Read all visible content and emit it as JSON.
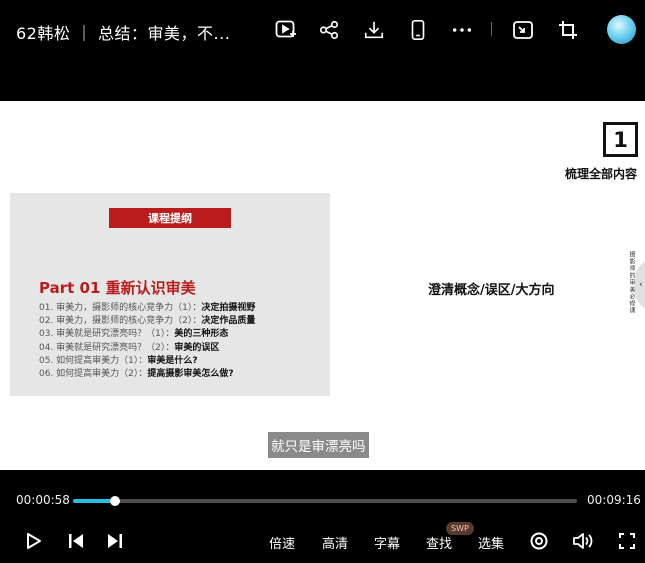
{
  "header": {
    "title": "62韩松 ｜ 总结：审美，不...",
    "icons": [
      "picture-in-picture-icon",
      "share-icon",
      "download-icon",
      "mobile-icon",
      "more-icon",
      "mini-window-icon",
      "crop-icon",
      "avatar"
    ]
  },
  "slide": {
    "number": "1",
    "outline_label": "梳理全部内容",
    "banner": "课程提纲",
    "part_title": "Part 01  重新认识审美",
    "items": [
      {
        "prefix": "01. 审美力，摄影师的核心竞争力（1）：",
        "bold": "决定拍摄视野"
      },
      {
        "prefix": "02. 审美力，摄影师的核心竞争力（2）：",
        "bold": "决定作品质量"
      },
      {
        "prefix": "03. 审美就是研究漂亮吗？（1）：",
        "bold": "美的三种形态"
      },
      {
        "prefix": "04. 审美就是研究漂亮吗？（2）：",
        "bold": "审美的误区"
      },
      {
        "prefix": "05. 如何提高审美力（1）：",
        "bold": "审美是什么?"
      },
      {
        "prefix": "06. 如何提高审美力（2）：",
        "bold": "提高摄影审美怎么做?"
      }
    ],
    "center_text": "澄清概念/误区/大方向",
    "side_tab_text": "摄影师的审美必修课",
    "side_tab_arrow": "‹",
    "subtitle": "就只是审漂亮吗"
  },
  "player": {
    "current_time": "00:00:58",
    "total_time": "00:09:16",
    "progress": 0.083,
    "speed_label": "倍速",
    "quality_label": "高清",
    "caption_label": "字幕",
    "search_label": "查找",
    "search_badge": "SWP",
    "episodes_label": "选集",
    "accent_color": "#25bfe6"
  }
}
